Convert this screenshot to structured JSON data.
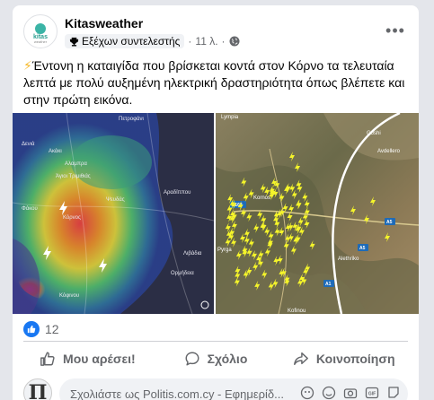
{
  "post": {
    "page_name": "Kitasweather",
    "badge_label": "Εξέχων συντελεστής",
    "time": "11 λ.",
    "separator": "·",
    "more_label": "•••",
    "emoji": "⚡",
    "text": "Έντονη η καταιγίδα που βρίσκεται κοντά στον Κόρνο τα τελευταία λεπτά με πολύ αυξημένη ηλεκτρική δραστηριότητα όπως βλέπετε και στην πρώτη εικόνα.",
    "logo_text": "kitas",
    "logo_sub": "weather"
  },
  "map_left": {
    "places": [
      "Πετροφάνι",
      "Δενιά",
      "Ακάκι",
      "Αλαμπρα",
      "Άγιοι Τριμιθιάς",
      "Αραδίππου",
      "Ψευδάς",
      "Φάκου",
      "Κόρνος",
      "Λιβάδια",
      "Ορμήδεια",
      "Κόφινου"
    ]
  },
  "map_right": {
    "places": [
      "Lympia",
      "Goshi",
      "Avdellero",
      "Kornos",
      "Pyrga",
      "Alethriko",
      "Kofinou"
    ],
    "roads": [
      "E163",
      "A5",
      "A5",
      "A1"
    ]
  },
  "reactions": {
    "count": "12"
  },
  "actions": {
    "like_label": "Μου αρέσει!",
    "comment_label": "Σχόλιο",
    "share_label": "Κοινοποίηση"
  },
  "comment": {
    "avatar_letter": "Π",
    "placeholder": "Σχολιάστε ως Politis.com.cy - Εφημερίδ..."
  },
  "colors": {
    "accent": "#1877f2",
    "lightning": "#f5f52a"
  }
}
